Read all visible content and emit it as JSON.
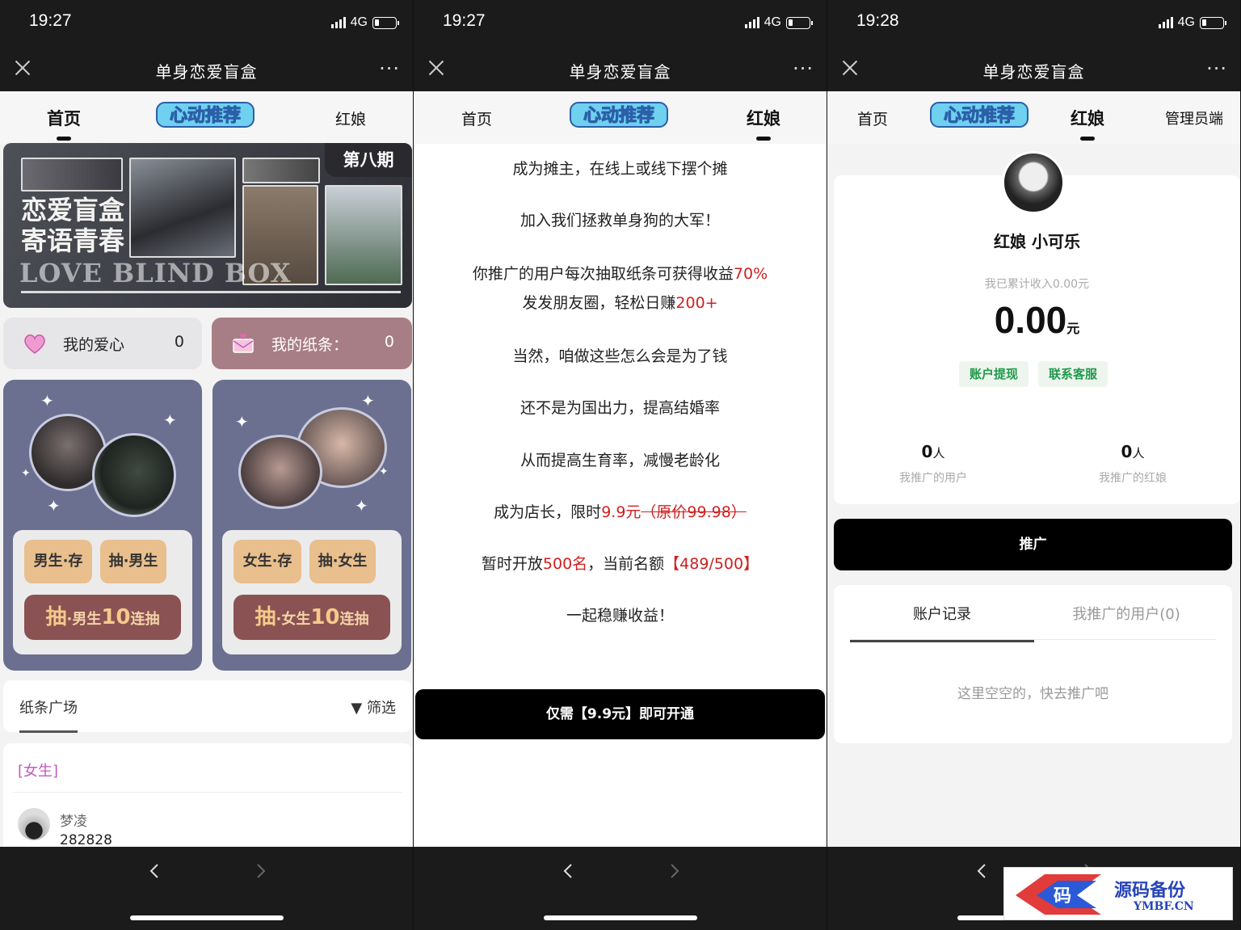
{
  "common": {
    "app_title": "单身恋爱盲盒",
    "network": "4G",
    "more": "···",
    "logo_text": "心动推荐"
  },
  "phone1": {
    "time": "19:27",
    "tabs": {
      "home": "首页",
      "matchmaker": "红娘"
    },
    "banner": {
      "issue": "第八期",
      "title_line1": "恋爱盲盒",
      "title_line2": "寄语青春",
      "subtitle": "LOVE BLIND BOX"
    },
    "counters": [
      {
        "label": "我的爱心",
        "value": "0",
        "icon": "heart-icon"
      },
      {
        "label": "我的纸条：",
        "value": "0",
        "icon": "envelope-icon"
      }
    ],
    "male_card": {
      "deposit": "男生·存",
      "draw": "抽·男生",
      "draw10_a": "抽",
      "draw10_b": "·男生",
      "draw10_c": "10",
      "draw10_d": "连抽"
    },
    "female_card": {
      "deposit": "女生·存",
      "draw": "抽·女生",
      "draw10_a": "抽",
      "draw10_b": "·女生",
      "draw10_c": "10",
      "draw10_d": "连抽"
    },
    "plaza": {
      "title": "纸条广场",
      "filter": "筛选"
    },
    "feed": {
      "gender": "[女生]",
      "name": "梦凌",
      "number": "282828"
    }
  },
  "phone2": {
    "time": "19:27",
    "tabs": {
      "home": "首页",
      "matchmaker": "红娘"
    },
    "lines": {
      "l1": "成为摊主，在线上或线下摆个摊",
      "l2": "加入我们拯救单身狗的大军！",
      "l3a": "你推广的用户每次抽取纸条可获得收益",
      "l3b": "70%",
      "l4a": "发发朋友圈，轻松日赚",
      "l4b": "200+",
      "l5": "当然，咱做这些怎么会是为了钱",
      "l6": "还不是为国出力，提高结婚率",
      "l7": "从而提高生育率，减慢老龄化",
      "l8a": "成为店长，限时",
      "l8b": "9.9元",
      "l8c": "（原价99.98）",
      "l9a": "暂时开放",
      "l9b": "500名",
      "l9c": "，当前名额",
      "l9d": "【489/500】",
      "l10": "一起稳赚收益！"
    },
    "button": "仅需【9.9元】即可开通"
  },
  "phone3": {
    "time": "19:28",
    "tabs": {
      "home": "首页",
      "matchmaker": "红娘",
      "admin": "管理员端"
    },
    "profile": {
      "name": "红娘 小可乐",
      "earn_label": "我已累计收入0.00元",
      "amount": "0.00",
      "unit": "元",
      "withdraw": "账户提现",
      "support": "联系客服"
    },
    "stats": [
      {
        "value": "0",
        "unit": "人",
        "label": "我推广的用户"
      },
      {
        "value": "0",
        "unit": "人",
        "label": "我推广的红娘"
      }
    ],
    "promote": "推广",
    "record_tabs": {
      "records": "账户记录",
      "users": "我推广的用户(0)"
    },
    "empty": "这里空空的，快去推广吧"
  },
  "watermark": {
    "title": "源码备份",
    "sub": "YMBF.CN",
    "glyph": "码"
  }
}
